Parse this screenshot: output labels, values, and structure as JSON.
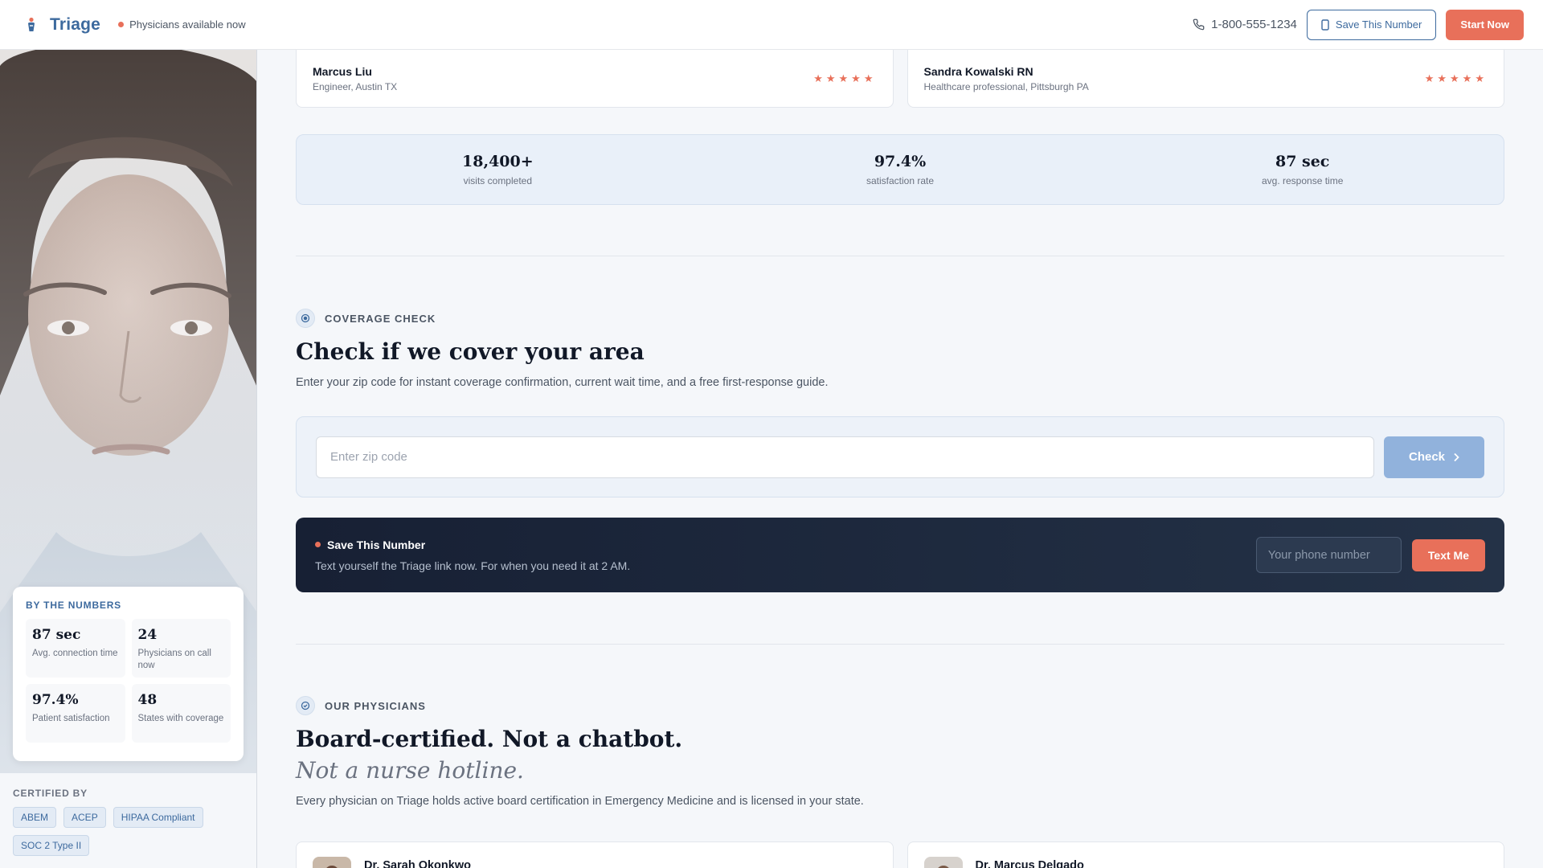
{
  "header": {
    "brand": "Triage",
    "availability": "Physicians available now",
    "phone": "1-800-555-1234",
    "save_label": "Save This Number",
    "start_label": "Start Now"
  },
  "sidebar": {
    "stats_title": "BY THE NUMBERS",
    "stats": [
      {
        "value": "87 sec",
        "label": "Avg. connection time"
      },
      {
        "value": "24",
        "label": "Physicians on call now"
      },
      {
        "value": "97.4%",
        "label": "Patient satisfaction"
      },
      {
        "value": "48",
        "label": "States with coverage"
      }
    ],
    "certified_title": "CERTIFIED BY",
    "certifications": [
      "ABEM",
      "ACEP",
      "HIPAA Compliant",
      "SOC 2 Type II"
    ]
  },
  "testimonials": [
    {
      "name": "Marcus Liu",
      "role": "Engineer, Austin TX",
      "stars": "★★★★★"
    },
    {
      "name": "Sandra Kowalski RN",
      "role": "Healthcare professional, Pittsburgh PA",
      "stars": "★★★★★"
    }
  ],
  "metrics": [
    {
      "value": "18,400+",
      "label": "visits completed"
    },
    {
      "value": "97.4%",
      "label": "satisfaction rate"
    },
    {
      "value": "87 sec",
      "label": "avg. response time"
    }
  ],
  "coverage": {
    "eyebrow": "COVERAGE CHECK",
    "title": "Check if we cover your area",
    "lead": "Enter your zip code for instant coverage confirmation, current wait time, and a free first-response guide.",
    "zip_placeholder": "Enter zip code",
    "check_label": "Check"
  },
  "save_number": {
    "title": "Save This Number",
    "subtitle": "Text yourself the Triage link now. For when you need it at 2 AM.",
    "phone_placeholder": "Your phone number",
    "button_label": "Text Me"
  },
  "physicians": {
    "eyebrow": "OUR PHYSICIANS",
    "title": "Board-certified. Not a chatbot.",
    "title_italic": "Not a nurse hotline.",
    "lead": "Every physician on Triage holds active board certification in Emergency Medicine and is licensed in your state.",
    "cards": [
      {
        "name": "Dr. Sarah Okonkwo"
      },
      {
        "name": "Dr. Marcus Delgado"
      }
    ]
  },
  "colors": {
    "brand": "#3d6a9e",
    "accent": "#e8705a",
    "dark_panel": "#1b2538"
  }
}
